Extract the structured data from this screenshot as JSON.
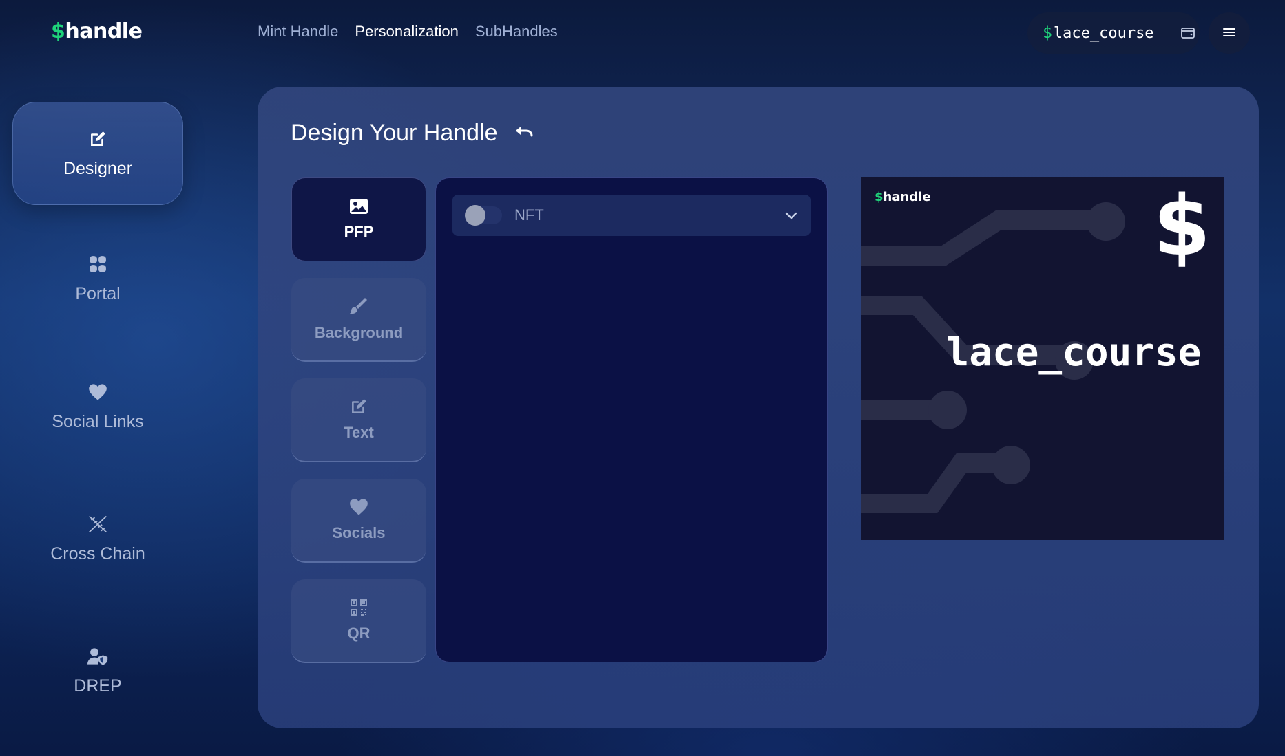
{
  "header": {
    "logo_dollar": "$",
    "logo_text": "handle",
    "nav": [
      "Mint Handle",
      "Personalization",
      "SubHandles"
    ],
    "active_nav": "Personalization",
    "user_handle_prefix": "$",
    "user_handle": "lace_course"
  },
  "sidebar": {
    "items": [
      {
        "label": "Designer",
        "icon": "edit-icon",
        "active": true
      },
      {
        "label": "Portal",
        "icon": "grid-icon",
        "active": false
      },
      {
        "label": "Social Links",
        "icon": "heart-icon",
        "active": false
      },
      {
        "label": "Cross Chain",
        "icon": "cross-chain-icon",
        "active": false
      },
      {
        "label": "DREP",
        "icon": "user-shield-icon",
        "active": false
      }
    ]
  },
  "designer": {
    "title": "Design Your Handle",
    "tabs": [
      {
        "label": "PFP",
        "icon": "image-icon",
        "active": true
      },
      {
        "label": "Background",
        "icon": "brush-icon",
        "active": false
      },
      {
        "label": "Text",
        "icon": "edit-icon",
        "active": false
      },
      {
        "label": "Socials",
        "icon": "heart-icon",
        "active": false
      },
      {
        "label": "QR",
        "icon": "qr-icon",
        "active": false
      }
    ],
    "nft_selector": {
      "label": "NFT",
      "toggle_on": false
    }
  },
  "preview": {
    "logo_dollar": "$",
    "logo_text": "handle",
    "big_symbol": "$",
    "handle_name": "lace_course"
  },
  "colors": {
    "accent_green": "#1fd37a",
    "panel_bg": "#34487f",
    "active_tab_bg": "#0f1647",
    "preview_bg": "#121431"
  }
}
